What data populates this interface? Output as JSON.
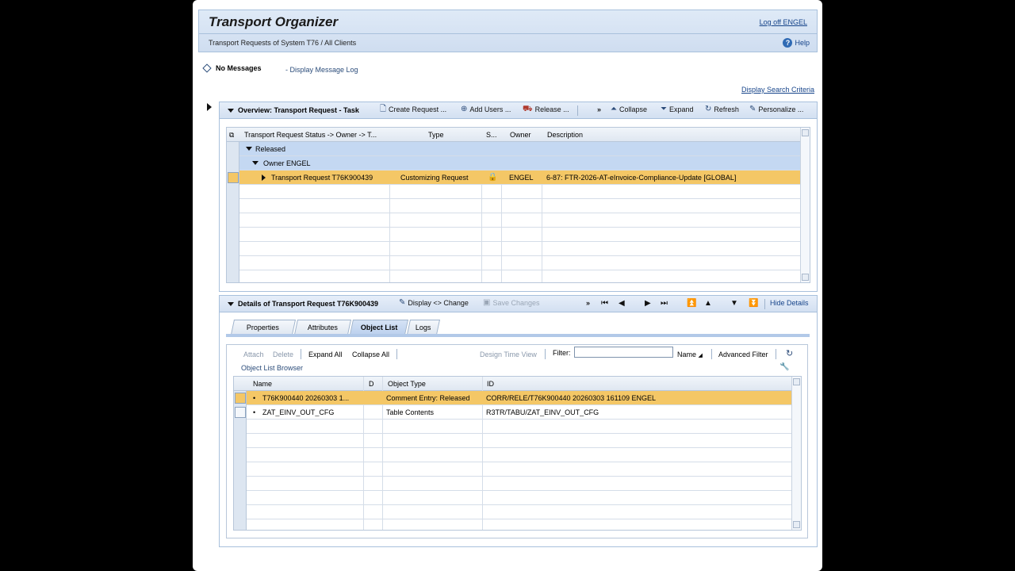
{
  "header": {
    "title": "Transport Organizer",
    "subtitle": "Transport Requests of System T76 / All Clients",
    "logoff": "Log off ENGEL",
    "help": "Help"
  },
  "messages": {
    "status": "No Messages",
    "display_log": "- Display Message Log",
    "search_criteria": "Display Search Criteria"
  },
  "overview": {
    "title": "Overview: Transport Request - Task",
    "toolbar": {
      "create": "Create Request ...",
      "add_users": "Add Users ...",
      "release": "Release ...",
      "more": "»",
      "collapse": "Collapse",
      "expand": "Expand",
      "refresh": "Refresh",
      "personalize": "Personalize ..."
    },
    "columns": [
      "Transport Request Status -> Owner -> T...",
      "Type",
      "S...",
      "Owner",
      "Description"
    ],
    "group1": "Released",
    "group2": "Owner ENGEL",
    "row": {
      "request": "Transport Request T76K900439",
      "type": "Customizing Request",
      "owner": "ENGEL",
      "description": "6-87: FTR-2026-AT-eInvoice-Compliance-Update [GLOBAL]"
    }
  },
  "details": {
    "title": "Details of Transport Request T76K900439",
    "display_change": "Display <> Change",
    "save_changes": "Save Changes",
    "more": "»",
    "hide_details": "Hide Details",
    "tabs": [
      "Properties",
      "Attributes",
      "Object List",
      "Logs"
    ],
    "active_tab": "Object List"
  },
  "object_list": {
    "toolbar": {
      "attach": "Attach",
      "delete": "Delete",
      "expand_all": "Expand All",
      "collapse_all": "Collapse All",
      "design_time_view": "Design Time View",
      "filter_label": "Filter:",
      "filter_value": "",
      "name_sort": "Name",
      "advanced_filter": "Advanced Filter"
    },
    "browser_label": "Object List Browser",
    "columns": [
      "Name",
      "D",
      "Object Type",
      "ID"
    ],
    "rows": [
      {
        "name": "T76K900440 20260303 1...",
        "d": "",
        "object_type": "Comment Entry: Released",
        "id": "CORR/RELE/T76K900440 20260303 161109 ENGEL"
      },
      {
        "name": "ZAT_EINV_OUT_CFG",
        "d": "",
        "object_type": "Table Contents",
        "id": "R3TR/TABU/ZAT_EINV_OUT_CFG"
      }
    ]
  },
  "colors": {
    "highlight_row": "#f4c766",
    "group_row": "#c4d8f2",
    "header_bg": "#dfeaf7",
    "link": "#16448a"
  }
}
